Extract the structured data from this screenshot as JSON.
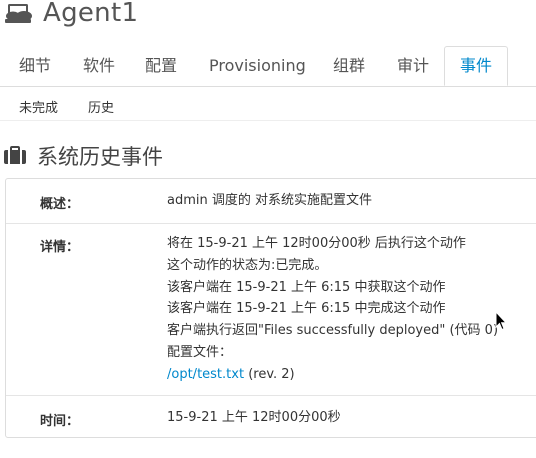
{
  "header": {
    "system_name": "Agent1",
    "icon": "system-icon"
  },
  "tabs": [
    {
      "label": "细节"
    },
    {
      "label": "软件"
    },
    {
      "label": "配置"
    },
    {
      "label": "Provisioning"
    },
    {
      "label": "组群"
    },
    {
      "label": "审计"
    },
    {
      "label": "事件",
      "active": true
    }
  ],
  "subtabs": [
    {
      "label": "未完成"
    },
    {
      "label": "历史"
    }
  ],
  "section": {
    "title": "系统历史事件",
    "icon": "briefcase-icon"
  },
  "event": {
    "summary_label": "概述：",
    "summary_value": "admin 调度的 对系统实施配置文件",
    "details_label": "详情：",
    "details_lines": [
      "将在 15-9-21 上午 12时00分00秒 后执行这个动作",
      "这个动作的状态为:已完成。",
      "该客户端在 15-9-21 上午 6:15 中获取这个动作",
      "该客户端在 15-9-21 上午 6:15 中完成这个动作",
      "客户端执行返回\"Files successfully deployed\" (代码 0)",
      "配置文件："
    ],
    "config_file_link": "/opt/test.txt",
    "config_file_rev": " (rev. 2)",
    "time_label": "时间：",
    "time_value": "15-9-21 上午 12时00分00秒"
  },
  "colors": {
    "link": "#0088cc",
    "border": "#dddddd",
    "text": "#333333"
  }
}
